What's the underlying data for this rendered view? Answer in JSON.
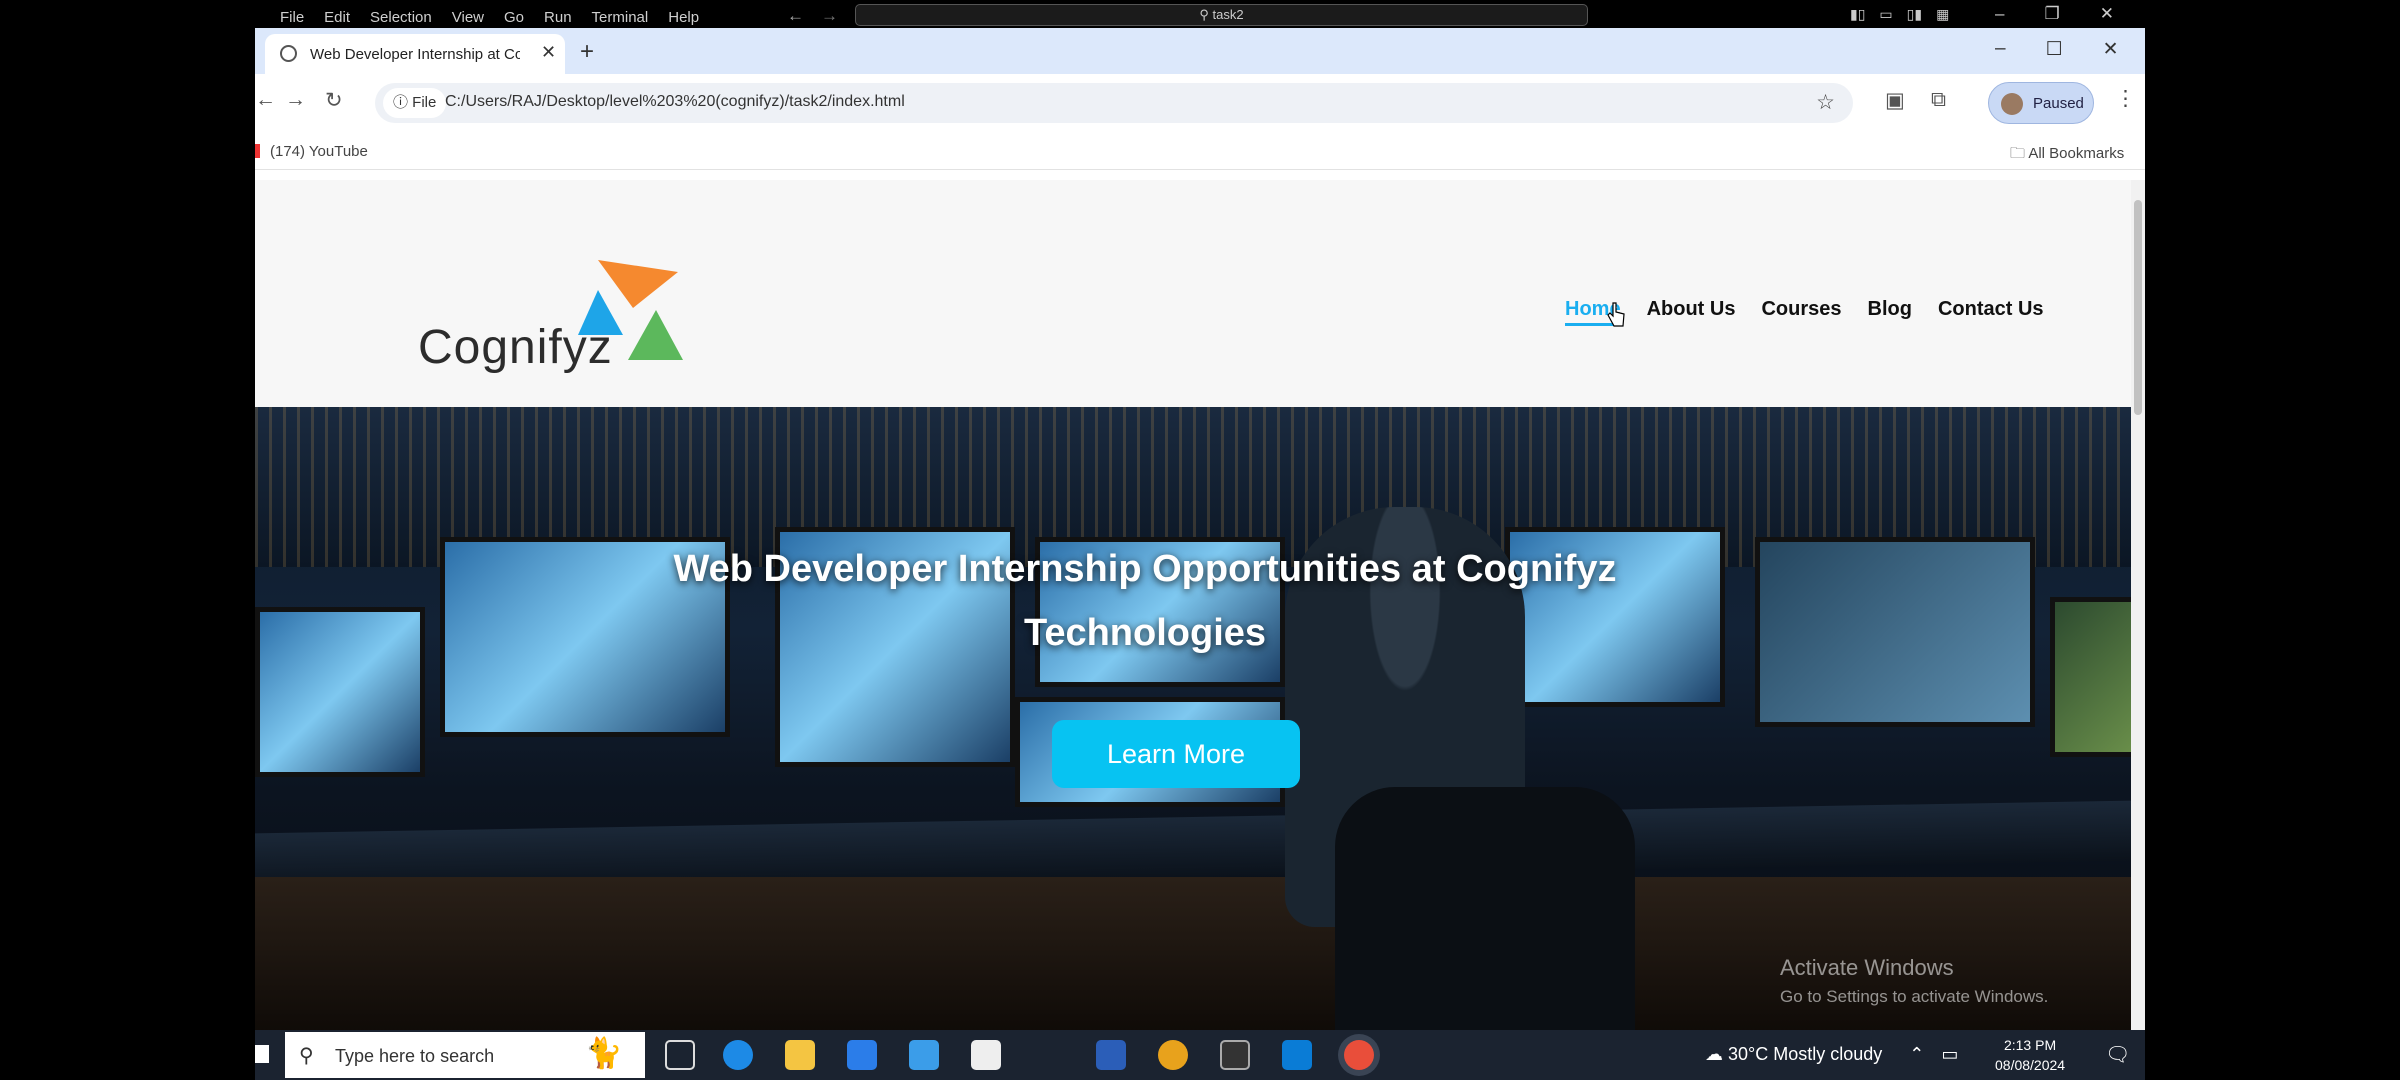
{
  "vscode": {
    "menu": [
      "File",
      "Edit",
      "Selection",
      "View",
      "Go",
      "Run",
      "Terminal",
      "Help"
    ],
    "search_text": "task2"
  },
  "browser": {
    "tab_title": "Web Developer Internship at Co",
    "address_chip": "File",
    "url": "C:/Users/RAJ/Desktop/level%203%20(cognifyz)/task2/index.html",
    "profile_label": "Paused",
    "bookmark_youtube": "(174) YouTube",
    "all_bookmarks": "All Bookmarks"
  },
  "site": {
    "logo_text": "Cognifyz",
    "nav": [
      "Home",
      "About Us",
      "Courses",
      "Blog",
      "Contact Us"
    ],
    "active_nav": "Home",
    "hero_title_line1": "Web Developer Internship Opportunities at Cognifyz",
    "hero_title_line2": "Technologies",
    "cta_label": "Learn More",
    "logo_colors": {
      "orange": "#f5892f",
      "blue": "#1ea5e8",
      "green": "#5cb85c"
    },
    "accent_color": "#07c3f2"
  },
  "watermark": {
    "line1": "Activate Windows",
    "line2": "Go to Settings to activate Windows."
  },
  "taskbar": {
    "search_placeholder": "Type here to search",
    "weather": "30°C  Mostly cloudy",
    "time": "2:13 PM",
    "date": "08/08/2024"
  }
}
